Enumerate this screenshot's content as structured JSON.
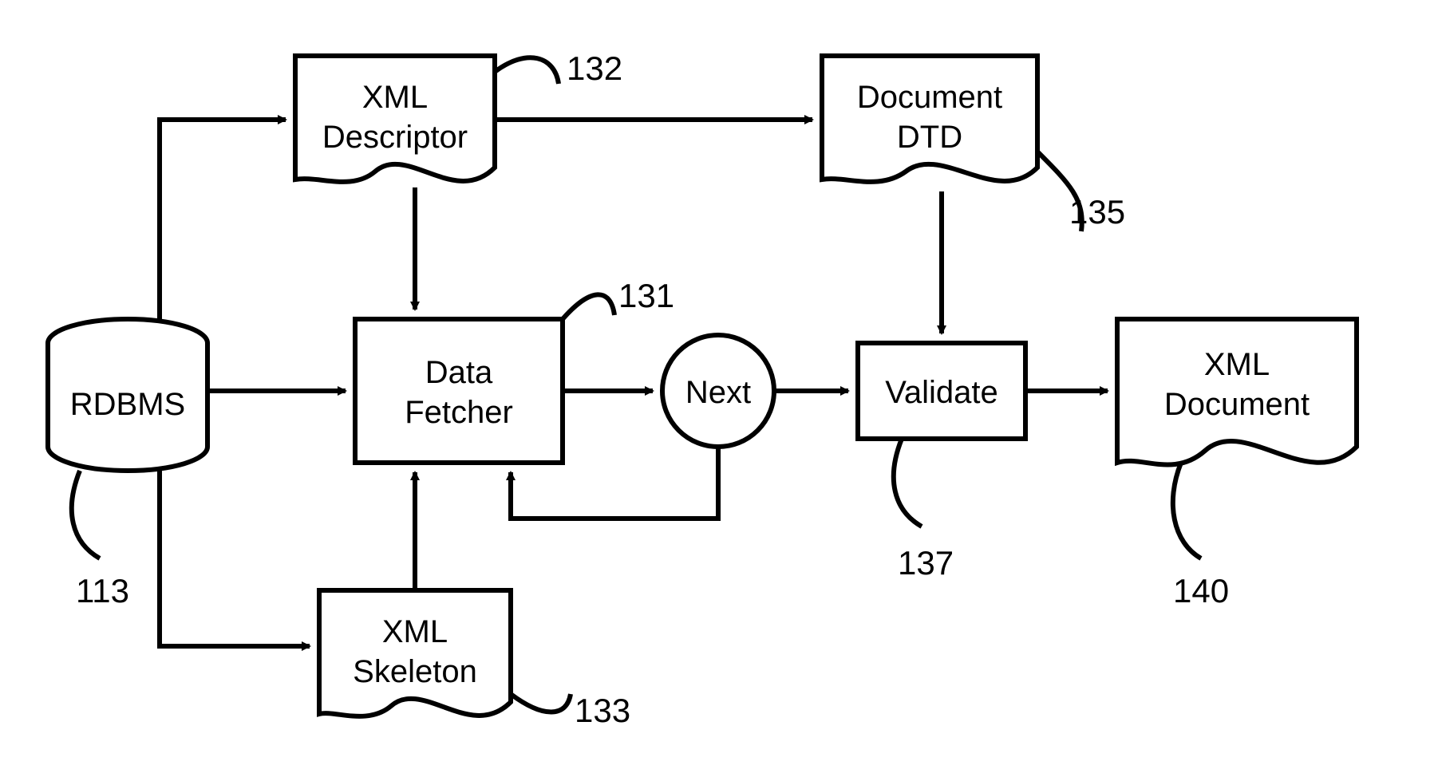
{
  "nodes": {
    "rdbms": {
      "label": "RDBMS",
      "ref": "113"
    },
    "xml_descriptor": {
      "line1": "XML",
      "line2": "Descriptor",
      "ref": "132"
    },
    "xml_skeleton": {
      "line1": "XML",
      "line2": "Skeleton",
      "ref": "133"
    },
    "data_fetcher": {
      "line1": "Data",
      "line2": "Fetcher",
      "ref": "131"
    },
    "next": {
      "label": "Next"
    },
    "document_dtd": {
      "line1": "Document",
      "line2": "DTD",
      "ref": "135"
    },
    "validate": {
      "label": "Validate",
      "ref": "137"
    },
    "xml_document": {
      "line1": "XML",
      "line2": "Document",
      "ref": "140"
    }
  }
}
